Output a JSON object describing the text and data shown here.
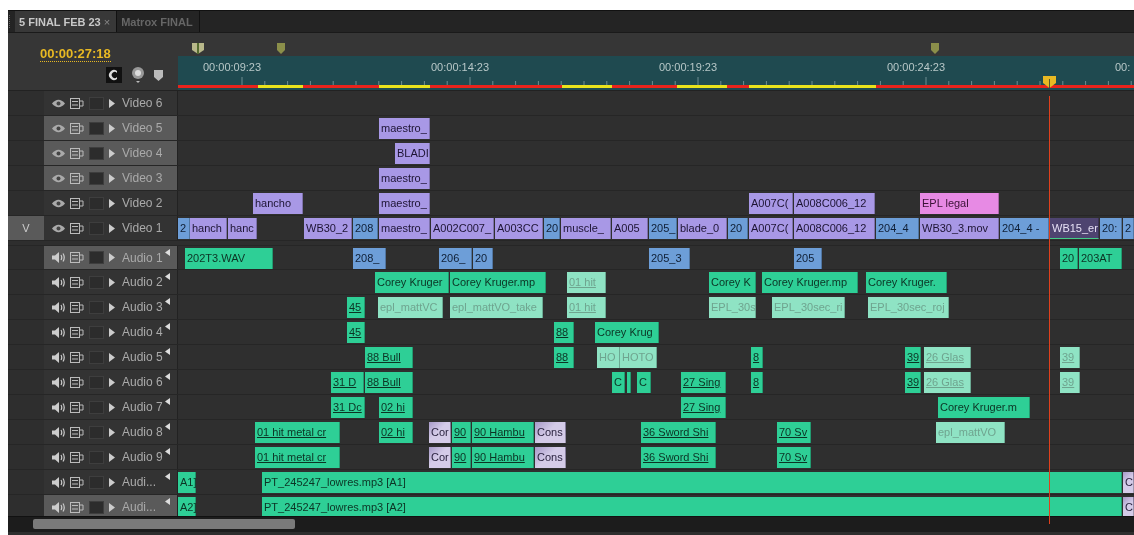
{
  "tabs": [
    {
      "label": "5 FINAL FEB 23",
      "selected": true,
      "close": "×"
    },
    {
      "label": "Matrox FINAL",
      "selected": false
    }
  ],
  "timecode": "00:00:27:18",
  "ruler": [
    "00:00:09:23",
    "00:00:14:23",
    "00:00:19:23",
    "00:00:24:23",
    "00:"
  ],
  "tracks": [
    {
      "name": "Video 6",
      "kind": "video",
      "highlighted": false
    },
    {
      "name": "Video 5",
      "kind": "video",
      "highlighted": true,
      "clips": [
        {
          "label": "maestro_",
          "kind": "video"
        }
      ]
    },
    {
      "name": "Video 4",
      "kind": "video",
      "highlighted": true,
      "clips": [
        {
          "label": "BLADI",
          "kind": "video"
        }
      ]
    },
    {
      "name": "Video 3",
      "kind": "video",
      "highlighted": true,
      "clips": [
        {
          "label": "maestro_",
          "kind": "video"
        }
      ]
    },
    {
      "name": "Video 2",
      "kind": "video",
      "highlighted": false,
      "clips": [
        {
          "label": "hancho",
          "kind": "video"
        },
        {
          "label": "maestro_",
          "kind": "video"
        },
        {
          "label": "A007C(",
          "kind": "video"
        },
        {
          "label": "A008C006_12",
          "kind": "video"
        },
        {
          "label": "EPL legal",
          "kind": "title"
        }
      ]
    },
    {
      "name": "Video 1",
      "kind": "video",
      "highlighted": false,
      "source": "V",
      "clips": [
        {
          "label": "2",
          "kind": "nested"
        },
        {
          "label": "hanch",
          "kind": "video"
        },
        {
          "label": "hanc",
          "kind": "video"
        },
        {
          "label": "WB30_2",
          "kind": "video"
        },
        {
          "label": "208",
          "kind": "nested"
        },
        {
          "label": "maestro_",
          "kind": "video"
        },
        {
          "label": "A002C007_",
          "kind": "video"
        },
        {
          "label": "A003CC",
          "kind": "video"
        },
        {
          "label": "20",
          "kind": "nested"
        },
        {
          "label": "muscle_",
          "kind": "video"
        },
        {
          "label": "A005",
          "kind": "video"
        },
        {
          "label": "205_",
          "kind": "nested"
        },
        {
          "label": "blade_0",
          "kind": "video"
        },
        {
          "label": "20",
          "kind": "nested"
        },
        {
          "label": "A007C(",
          "kind": "video"
        },
        {
          "label": "A008C006_12",
          "kind": "video"
        },
        {
          "label": "204_4",
          "kind": "nested"
        },
        {
          "label": "WB30_3.mov",
          "kind": "video"
        },
        {
          "label": "204_4 -",
          "kind": "nested"
        },
        {
          "label": "WB15_er",
          "kind": "video-dark"
        },
        {
          "label": "20:",
          "kind": "nested"
        },
        {
          "label": "2",
          "kind": "nested"
        }
      ]
    },
    {
      "name": "Audio 1",
      "kind": "audio",
      "highlighted": true,
      "clips": [
        {
          "label": "202T3.WAV",
          "kind": "audio"
        },
        {
          "label": "208_",
          "kind": "nested"
        },
        {
          "label": "206_",
          "kind": "nested"
        },
        {
          "label": "20",
          "kind": "nested"
        },
        {
          "label": "205_3",
          "kind": "nested"
        },
        {
          "label": "205",
          "kind": "nested"
        },
        {
          "label": "20",
          "kind": "audio"
        },
        {
          "label": "203AT",
          "kind": "audio"
        }
      ]
    },
    {
      "name": "Audio 2",
      "kind": "audio",
      "highlighted": false,
      "clips": [
        {
          "label": "Corey Kruger",
          "kind": "audio"
        },
        {
          "label": "Corey Kruger.mp",
          "kind": "audio"
        },
        {
          "label": "01 hit",
          "kind": "disabled-underlined"
        },
        {
          "label": "Corey K",
          "kind": "audio"
        },
        {
          "label": "Corey Kruger.mp",
          "kind": "audio"
        },
        {
          "label": "Corey Kruger.",
          "kind": "audio"
        }
      ]
    },
    {
      "name": "Audio 3",
      "kind": "audio",
      "highlighted": false,
      "clips": [
        {
          "label": "45",
          "kind": "audio-underlined"
        },
        {
          "label": "epl_mattVC",
          "kind": "disabled"
        },
        {
          "label": "epl_mattVO_take",
          "kind": "disabled"
        },
        {
          "label": "01 hit",
          "kind": "disabled-underlined"
        },
        {
          "label": "EPL_30s",
          "kind": "disabled"
        },
        {
          "label": "EPL_30sec_ri",
          "kind": "disabled"
        },
        {
          "label": "EPL_30sec_roj",
          "kind": "disabled"
        }
      ]
    },
    {
      "name": "Audio 4",
      "kind": "audio",
      "highlighted": false,
      "clips": [
        {
          "label": "45",
          "kind": "audio-underlined"
        },
        {
          "label": "88",
          "kind": "audio-underlined"
        },
        {
          "label": "Corey Krug",
          "kind": "audio"
        }
      ]
    },
    {
      "name": "Audio 5",
      "kind": "audio",
      "highlighted": false,
      "clips": [
        {
          "label": "88 Bull",
          "kind": "audio-underlined"
        },
        {
          "label": "88",
          "kind": "audio-underlined"
        },
        {
          "label": "HO",
          "kind": "disabled"
        },
        {
          "label": "HOTO",
          "kind": "disabled"
        },
        {
          "label": "8",
          "kind": "audio-underlined"
        },
        {
          "label": "39",
          "kind": "audio-underlined"
        },
        {
          "label": "26 Glas",
          "kind": "disabled-underlined"
        },
        {
          "label": "39",
          "kind": "disabled-underlined"
        }
      ]
    },
    {
      "name": "Audio 6",
      "kind": "audio",
      "highlighted": false,
      "clips": [
        {
          "label": "31 D",
          "kind": "audio-underlined"
        },
        {
          "label": "88 Bull",
          "kind": "audio-underlined"
        },
        {
          "label": "C",
          "kind": "audio"
        },
        {
          "kind": "audio"
        },
        {
          "label": "C",
          "kind": "audio"
        },
        {
          "label": "27 Sing",
          "kind": "audio-underlined"
        },
        {
          "label": "8",
          "kind": "audio-underlined"
        },
        {
          "label": "39",
          "kind": "audio-underlined"
        },
        {
          "label": "26 Glas",
          "kind": "disabled-underlined"
        },
        {
          "label": "39",
          "kind": "disabled-underlined"
        }
      ]
    },
    {
      "name": "Audio 7",
      "kind": "audio",
      "highlighted": false,
      "clips": [
        {
          "label": "31 Dc",
          "kind": "audio-underlined"
        },
        {
          "label": "02 hi",
          "kind": "audio-underlined"
        },
        {
          "label": "27 Sing",
          "kind": "audio-underlined"
        },
        {
          "label": "Corey Kruger.m",
          "kind": "audio"
        }
      ]
    },
    {
      "name": "Audio 8",
      "kind": "audio",
      "highlighted": false,
      "clips": [
        {
          "label": "01 hit metal cr",
          "kind": "audio-underlined"
        },
        {
          "label": "02 hi",
          "kind": "audio-underlined"
        },
        {
          "label": "Cor",
          "kind": "lavender"
        },
        {
          "label": "90",
          "kind": "audio-underlined"
        },
        {
          "label": "90 Hambu",
          "kind": "audio-underlined"
        },
        {
          "label": "Cons",
          "kind": "lavender"
        },
        {
          "label": "36 Sword Shi",
          "kind": "audio-underlined"
        },
        {
          "label": "70 Sv",
          "kind": "audio-underlined"
        },
        {
          "label": "epl_mattVO",
          "kind": "disabled"
        }
      ]
    },
    {
      "name": "Audio 9",
      "kind": "audio",
      "highlighted": false,
      "clips": [
        {
          "label": "01 hit metal cr",
          "kind": "audio-underlined"
        },
        {
          "label": "Cor",
          "kind": "lavender"
        },
        {
          "label": "90",
          "kind": "audio-underlined"
        },
        {
          "label": "90 Hambu",
          "kind": "audio-underlined"
        },
        {
          "label": "Cons",
          "kind": "lavender"
        },
        {
          "label": "36 Sword Shi",
          "kind": "audio-underlined"
        },
        {
          "label": "70 Sv",
          "kind": "audio-underlined"
        }
      ]
    },
    {
      "name": "Audi...",
      "kind": "audio",
      "highlighted": false,
      "clips": [
        {
          "label": "A1]",
          "kind": "audio"
        },
        {
          "label": "PT_245247_lowres.mp3 [A1]",
          "kind": "audio"
        },
        {
          "label": "C",
          "kind": "lavender"
        }
      ]
    },
    {
      "name": "Audi...",
      "kind": "audio",
      "highlighted": true,
      "clips": [
        {
          "label": "A2]",
          "kind": "audio"
        },
        {
          "label": "PT_245247_lowres.mp3 [A2]",
          "kind": "audio"
        },
        {
          "label": "C",
          "kind": "lavender"
        }
      ]
    }
  ]
}
